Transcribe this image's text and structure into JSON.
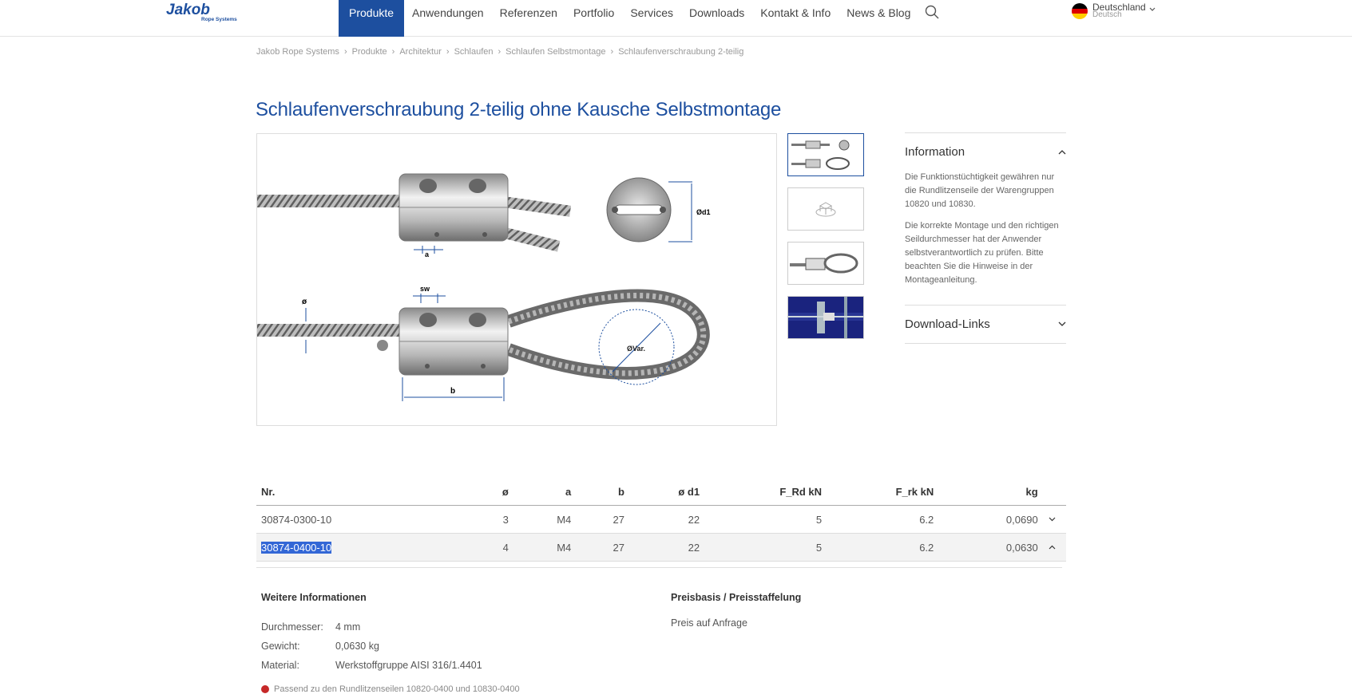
{
  "header": {
    "logo": {
      "brand": "Jakob",
      "tagline": "Rope Systems"
    },
    "nav": [
      {
        "label": "Produkte"
      },
      {
        "label": "Anwendungen"
      },
      {
        "label": "Referenzen"
      },
      {
        "label": "Portfolio"
      },
      {
        "label": "Services"
      },
      {
        "label": "Downloads"
      },
      {
        "label": "Kontakt & Info"
      },
      {
        "label": "News & Blog"
      }
    ],
    "language": {
      "country": "Deutschland",
      "language": "Deutsch"
    }
  },
  "breadcrumb": [
    "Jakob Rope Systems",
    "Produkte",
    "Architektur",
    "Schlaufen",
    "Schlaufen Selbstmontage",
    "Schlaufenverschraubung 2-teilig"
  ],
  "title": "Schlaufenverschraubung 2-teilig ohne Kausche Selbstmontage",
  "drawing_labels": {
    "a": "a",
    "d1": "Ød1",
    "sw": "sw",
    "diameter": "ø",
    "b": "b",
    "var": "ØVar."
  },
  "sidebar": {
    "information": {
      "label": "Information",
      "p1": "Die Funktionstüchtigkeit gewähren nur die Rundlitzenseile der Warengruppen 10820 und 10830.",
      "p2": "Die korrekte Montage und den richtigen Seildurchmesser hat der Anwender selbstverantwortlich zu prüfen. Bitte beachten Sie die Hinweise in der Montageanleitung."
    },
    "downloads": {
      "label": "Download-Links"
    }
  },
  "table": {
    "headers": [
      "Nr.",
      "ø",
      "a",
      "b",
      "ø d1",
      "F_Rd kN",
      "F_rk kN",
      "kg"
    ],
    "rows": [
      {
        "nr": "30874-0300-10",
        "d": "3",
        "a": "M4",
        "b": "27",
        "d1": "22",
        "frd": "5",
        "frk": "6.2",
        "kg": "0,0690"
      },
      {
        "nr": "30874-0400-10",
        "d": "4",
        "a": "M4",
        "b": "27",
        "d1": "22",
        "frd": "5",
        "frk": "6.2",
        "kg": "0,0630"
      }
    ]
  },
  "details": {
    "left_heading": "Weitere Informationen",
    "rows": [
      {
        "k": "Durchmesser:",
        "v": "4 mm"
      },
      {
        "k": "Gewicht:",
        "v": "0,0630 kg"
      },
      {
        "k": "Material:",
        "v": "Werkstoffgruppe AISI 316/1.4401"
      }
    ],
    "right_heading": "Preisbasis / Preisstaffelung",
    "price_text": "Preis auf Anfrage",
    "note": "Passend zu den Rundlitzenseilen 10820-0400 und 10830-0400"
  },
  "colors": {
    "brand_blue": "#1d4f9f",
    "selection": "#3367d6"
  }
}
